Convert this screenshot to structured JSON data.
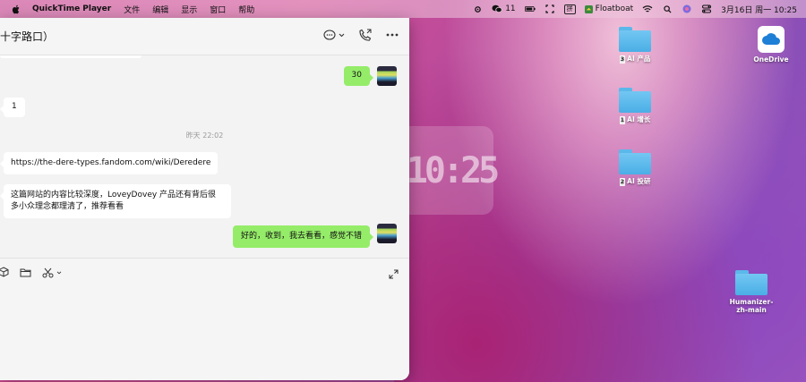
{
  "menubar": {
    "app_name": "QuickTime Player",
    "menus": [
      "文件",
      "编辑",
      "显示",
      "窗口",
      "帮助"
    ],
    "wechat_count": "11",
    "input_method": "拼",
    "floatboat": "Floatboat",
    "datetime": "3月16日 周一  10:25"
  },
  "chat": {
    "title": "十字路口）",
    "messages": {
      "m1": "30",
      "m2": "1",
      "time": "昨天 22:02",
      "m3": "https://the-dere-types.fandom.com/wiki/Deredere",
      "m4": "这篇网站的内容比较深度，LoveyDovey 产品还有背后很多小众理念都理清了，推荐看看",
      "m5": "好的，收到，我去看看，感觉不错"
    }
  },
  "clock": "10:25",
  "desktop": {
    "f1": {
      "num": "3",
      "name": "AI 产品"
    },
    "f2": {
      "num": "1",
      "name": "AI 增长"
    },
    "f3": {
      "num": "2",
      "name": "AI 投研"
    },
    "onedrive": "OneDrive",
    "humanizer": "Humanizer-zh-main"
  },
  "colors": {
    "bubble_out": "#95ec69",
    "bubble_in": "#ffffff",
    "folder": "#5bb8ea"
  }
}
